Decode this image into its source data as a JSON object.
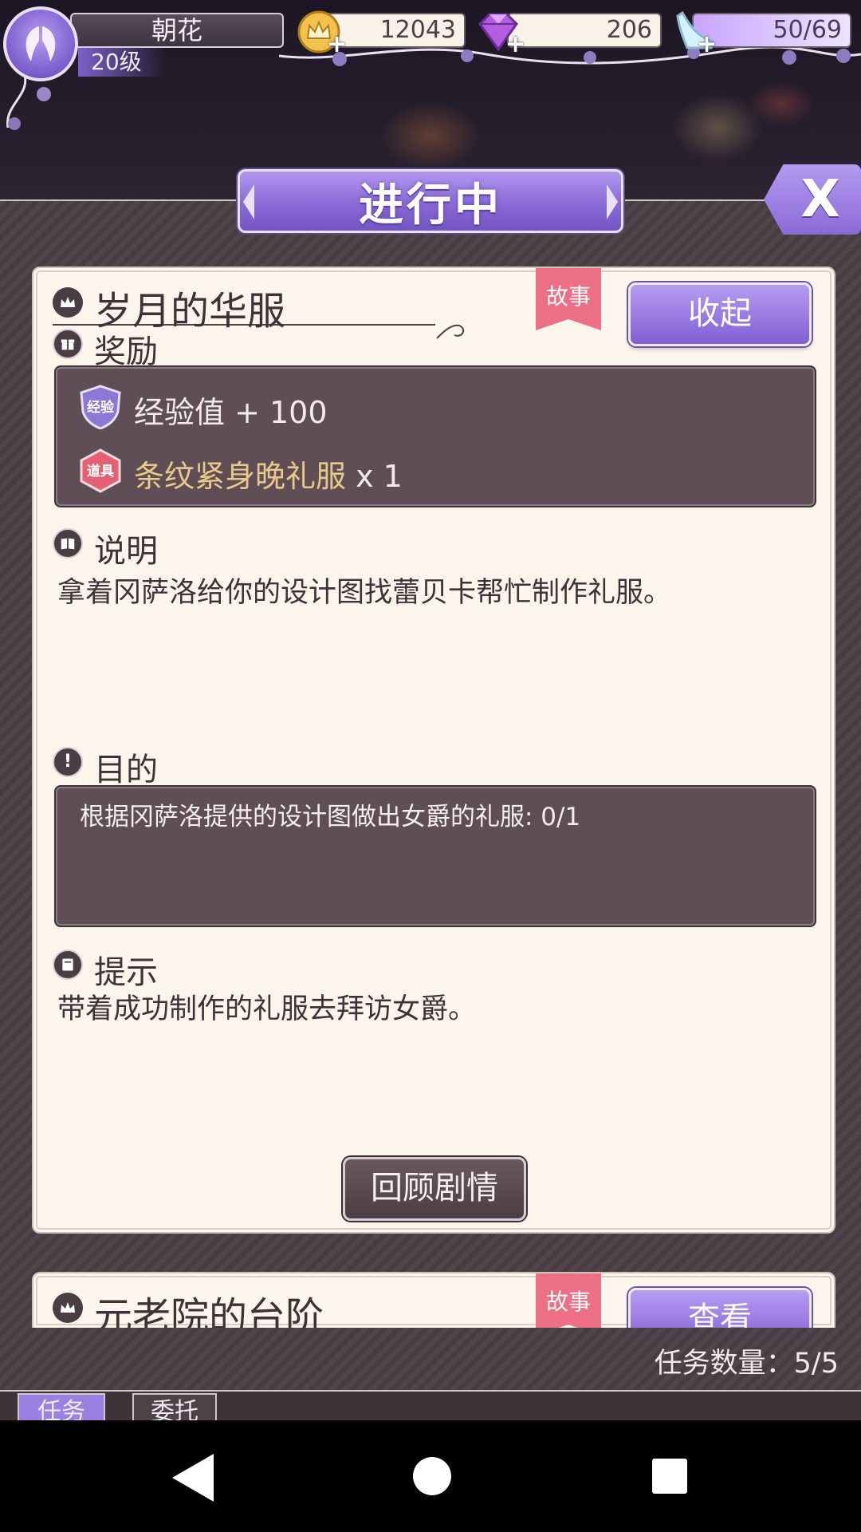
{
  "hud": {
    "player_name": "朝花",
    "player_level": "20级",
    "gold": "12043",
    "gems": "206",
    "stamina": "50/69",
    "plus_symbol": "+"
  },
  "header": {
    "title": "进行中",
    "close_label": "X"
  },
  "quest": {
    "title": "岁月的华服",
    "tag": "故事",
    "collapse_label": "收起",
    "reward_heading": "奖励",
    "rewards": [
      {
        "badge": "经验",
        "label": "经验值 + 100",
        "badge_color": "#8d78d8"
      },
      {
        "badge": "道具",
        "label": "条纹紧身晚礼服",
        "quantity": "x 1",
        "badge_color": "#e46073"
      }
    ],
    "description_heading": "说明",
    "description": "拿着冈萨洛给你的设计图找蕾贝卡帮忙制作礼服。",
    "objective_heading": "目的",
    "objective": "根据冈萨洛提供的设计图做出女爵的礼服: 0/1",
    "hint_heading": "提示",
    "hint": "带着成功制作的礼服去拜访女爵。",
    "review_label": "回顾剧情"
  },
  "quest2": {
    "title": "元老院的台阶",
    "tag": "故事",
    "view_label": "查看"
  },
  "footer": {
    "quest_count": "任务数量：5/5",
    "tabs": [
      "任务",
      "委托"
    ]
  },
  "icons": {
    "avatar": "angel-wings-icon",
    "gold": "crown-coin-icon",
    "gem": "purple-diamond-icon",
    "stamina": "glass-slipper-icon",
    "quest": "crown-icon",
    "reward": "gift-icon",
    "description": "book-icon",
    "objective": "exclamation-icon",
    "hint": "note-icon"
  },
  "colors": {
    "accent_purple": "#9676e0",
    "panel_cream": "#fbf5ec",
    "panel_dark": "#5f4e56",
    "story_pink": "#ec6f86",
    "item_gold": "#e8c98a"
  }
}
